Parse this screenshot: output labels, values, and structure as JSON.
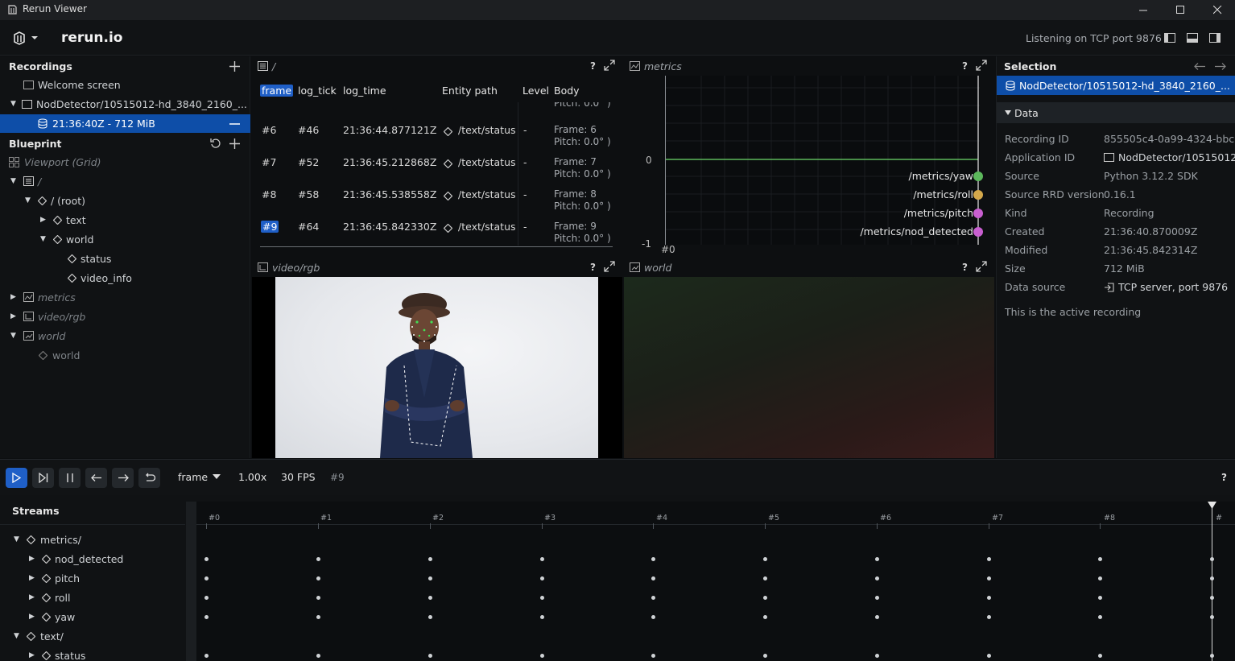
{
  "window": {
    "title": "Rerun Viewer"
  },
  "topbar": {
    "brand": "rerun.io",
    "status": "Listening on TCP port 9876"
  },
  "recordings": {
    "header": "Recordings",
    "welcome": "Welcome screen",
    "app": "NodDetector/10515012-hd_3840_2160_...",
    "recording": "21:36:40Z - 712 MiB"
  },
  "blueprint": {
    "header": "Blueprint",
    "viewport": "Viewport (Grid)",
    "container": "/",
    "root": "/ (root)",
    "text": "text",
    "world": "world",
    "status": "status",
    "video_info": "video_info",
    "metrics": "metrics",
    "video_rgb": "video/rgb",
    "world_view": "world",
    "world_entity": "world"
  },
  "textlog": {
    "title": "/",
    "columns": [
      "frame",
      "log_tick",
      "log_time",
      "Entity path",
      "Level",
      "Body"
    ],
    "partial_body": "Pitch: 0.0° )",
    "rows": [
      {
        "frame": "#6",
        "tick": "#46",
        "time": "21:36:44.877121Z",
        "path": "/text/status",
        "level": "-",
        "body1": "Frame: 6",
        "body2": "Pitch: 0.0° )"
      },
      {
        "frame": "#7",
        "tick": "#52",
        "time": "21:36:45.212868Z",
        "path": "/text/status",
        "level": "-",
        "body1": "Frame: 7",
        "body2": "Pitch: 0.0° )"
      },
      {
        "frame": "#8",
        "tick": "#58",
        "time": "21:36:45.538558Z",
        "path": "/text/status",
        "level": "-",
        "body1": "Frame: 8",
        "body2": "Pitch: 0.0° )"
      },
      {
        "frame": "#9",
        "tick": "#64",
        "time": "21:36:45.842330Z",
        "path": "/text/status",
        "level": "-",
        "body1": "Frame: 9",
        "body2": "Pitch: 0.0° )"
      }
    ]
  },
  "metrics": {
    "title": "metrics",
    "y_top_label": "0",
    "y_bottom_label": "-1",
    "x_label": "#0",
    "series": [
      {
        "name": "/metrics/yaw",
        "color": "#5cb85c"
      },
      {
        "name": "/metrics/roll",
        "color": "#d4a84b"
      },
      {
        "name": "/metrics/pitch",
        "color": "#c85fd0"
      },
      {
        "name": "/metrics/nod_detected",
        "color": "#c85fd0"
      }
    ]
  },
  "video": {
    "title": "video/rgb"
  },
  "world_view": {
    "title": "world"
  },
  "selection": {
    "header": "Selection",
    "item": "NodDetector/10515012-hd_3840_2160_...",
    "section": "Data",
    "fields": [
      {
        "k": "Recording ID",
        "v": "855505c4-0a99-4324-bbc"
      },
      {
        "k": "Application ID",
        "v": "NodDetector/10515012-"
      },
      {
        "k": "Source",
        "v": "Python 3.12.2 SDK"
      },
      {
        "k": "Source RRD version",
        "v": "0.16.1"
      },
      {
        "k": "Kind",
        "v": "Recording"
      },
      {
        "k": "Created",
        "v": "21:36:40.870009Z"
      },
      {
        "k": "Modified",
        "v": "21:36:45.842314Z"
      },
      {
        "k": "Size",
        "v": "712 MiB"
      },
      {
        "k": "Data source",
        "v": "TCP server, port 9876"
      }
    ],
    "note": "This is the active recording"
  },
  "timebar": {
    "timeline": "frame",
    "speed": "1.00x",
    "fps": "30 FPS",
    "current": "#9",
    "help": "?"
  },
  "streams": {
    "header": "Streams",
    "ticks": [
      "#0",
      "#1",
      "#2",
      "#3",
      "#4",
      "#5",
      "#6",
      "#7",
      "#8",
      "#"
    ],
    "metrics": "metrics/",
    "nod_detected": "nod_detected",
    "pitch": "pitch",
    "roll": "roll",
    "yaw": "yaw",
    "text": "text/",
    "status": "status"
  },
  "colors": {
    "accent": "#1f5fc7",
    "selection_bg": "#0e4ea8",
    "highlight": "#2e6fe0"
  }
}
